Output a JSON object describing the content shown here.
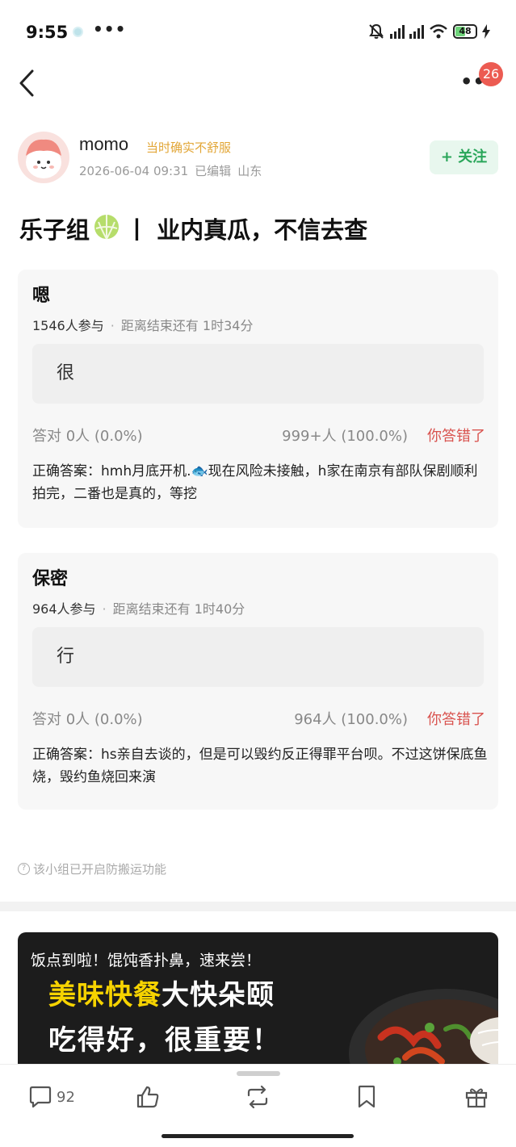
{
  "status_bar": {
    "time": "9:55",
    "more": "•••",
    "battery": "48",
    "icons": [
      "notification-dot-icon",
      "more-dots-icon",
      "mute-icon",
      "signal-icon",
      "signal-icon",
      "wifi-icon",
      "battery-icon",
      "charging-icon"
    ]
  },
  "nav": {
    "back_icon": "chevron-left-icon",
    "more_label": "••",
    "badge_count": "26"
  },
  "author": {
    "name": "momo",
    "tag": "当时确实不舒服",
    "date": "2026-06-04 09:31",
    "edited": "已编辑",
    "location": "山东",
    "follow_label": "+ 关注"
  },
  "post": {
    "title_part1": "乐子组",
    "title_emoji": "🍈",
    "title_part2": "丨 业内真瓜，不信去查"
  },
  "quizzes": [
    {
      "title": "嗯",
      "participants": "1546人参与",
      "countdown": "距离结束还有 1时34分",
      "option": "很",
      "correct_stat": "答对  0人 (0.0%)",
      "wrong_stat": "999+人 (100.0%)",
      "verdict": "你答错了",
      "answer": "正确答案：hmh月底开机.🐟现在风险未接触，h家在南京有部队保剧顺利拍完，二番也是真的，等挖"
    },
    {
      "title": "保密",
      "participants": "964人参与",
      "countdown": "距离结束还有 1时40分",
      "option": "行",
      "correct_stat": "答对  0人 (0.0%)",
      "wrong_stat": "964人 (100.0%)",
      "verdict": "你答错了",
      "answer": "正确答案：hs亲自去谈的，但是可以毁约反正得罪平台呗。不过这饼保底鱼烧，毁约鱼烧回来演"
    }
  ],
  "anti_repost_notice": "该小组已开启防搬运功能",
  "ad": {
    "subtitle": "饭点到啦！馄饨香扑鼻，速来尝！",
    "headline_highlight": "美味快餐",
    "headline_rest": "大快朵颐",
    "slogan": "吃得好，很重要！"
  },
  "bottom_bar": {
    "comment_count": "92",
    "icons": [
      "comment-icon",
      "like-icon",
      "repost-icon",
      "bookmark-icon",
      "gift-icon"
    ]
  },
  "colors": {
    "accent_green": "#2aa65a",
    "badge_red": "#ec5b52",
    "wrong_red": "#d9534f",
    "tag_gold": "#e2a636",
    "ad_yellow": "#f6d300"
  }
}
